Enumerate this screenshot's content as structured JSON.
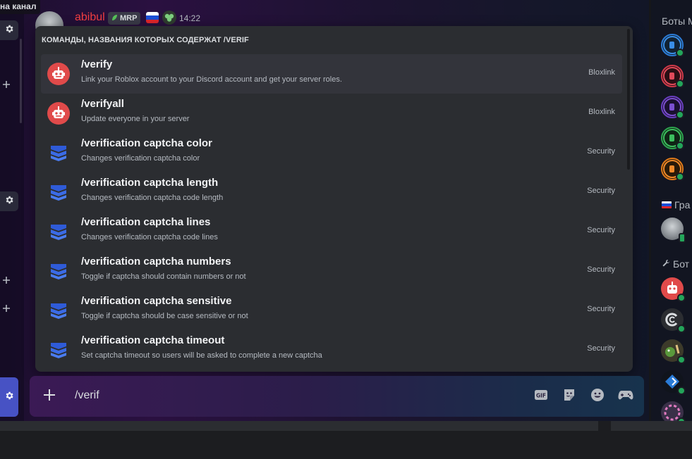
{
  "channel_label": "на канал",
  "message": {
    "username": "abibul",
    "tag": "MRP",
    "timestamp": "14:22"
  },
  "autocomplete": {
    "header": "КОМАНДЫ, НАЗВАНИЯ КОТОРЫХ СОДЕРЖАТ /VERIF",
    "commands": [
      {
        "name": "/verify",
        "description": "Link your Roblox account to your Discord account and get your server roles.",
        "app": "Bloxlink",
        "icon": "bloxlink-robot-icon"
      },
      {
        "name": "/verifyall",
        "description": "Update everyone in your server",
        "app": "Bloxlink",
        "icon": "bloxlink-robot-icon"
      },
      {
        "name": "/verification captcha color",
        "description": "Changes verification captcha color",
        "app": "Security",
        "icon": "security-layers-icon"
      },
      {
        "name": "/verification captcha length",
        "description": "Changes verification captcha code length",
        "app": "Security",
        "icon": "security-layers-icon"
      },
      {
        "name": "/verification captcha lines",
        "description": "Changes verification captcha code lines",
        "app": "Security",
        "icon": "security-layers-icon"
      },
      {
        "name": "/verification captcha numbers",
        "description": "Toggle if captcha should contain numbers or not",
        "app": "Security",
        "icon": "security-layers-icon"
      },
      {
        "name": "/verification captcha sensitive",
        "description": "Toggle if captcha should be case sensitive or not",
        "app": "Security",
        "icon": "security-layers-icon"
      },
      {
        "name": "/verification captcha timeout",
        "description": "Set captcha timeout so users will be asked to complete a new captcha",
        "app": "Security",
        "icon": "security-layers-icon"
      }
    ]
  },
  "input": {
    "value": "/verif",
    "icons": [
      "gif-icon",
      "sticker-icon",
      "emoji-icon",
      "game-controller-icon"
    ]
  },
  "members": {
    "groups": [
      {
        "label": "Боты М",
        "icon": ""
      },
      {
        "label": "Гра",
        "icon": "ru-flag-icon"
      },
      {
        "label": "Бот",
        "icon": "wrench-icon"
      }
    ]
  },
  "colors": {
    "accent": "#5865f2",
    "online": "#23a55a",
    "username": "#f23f42",
    "bloxlink": "#e04a4a",
    "security": "#3b5bdb"
  }
}
